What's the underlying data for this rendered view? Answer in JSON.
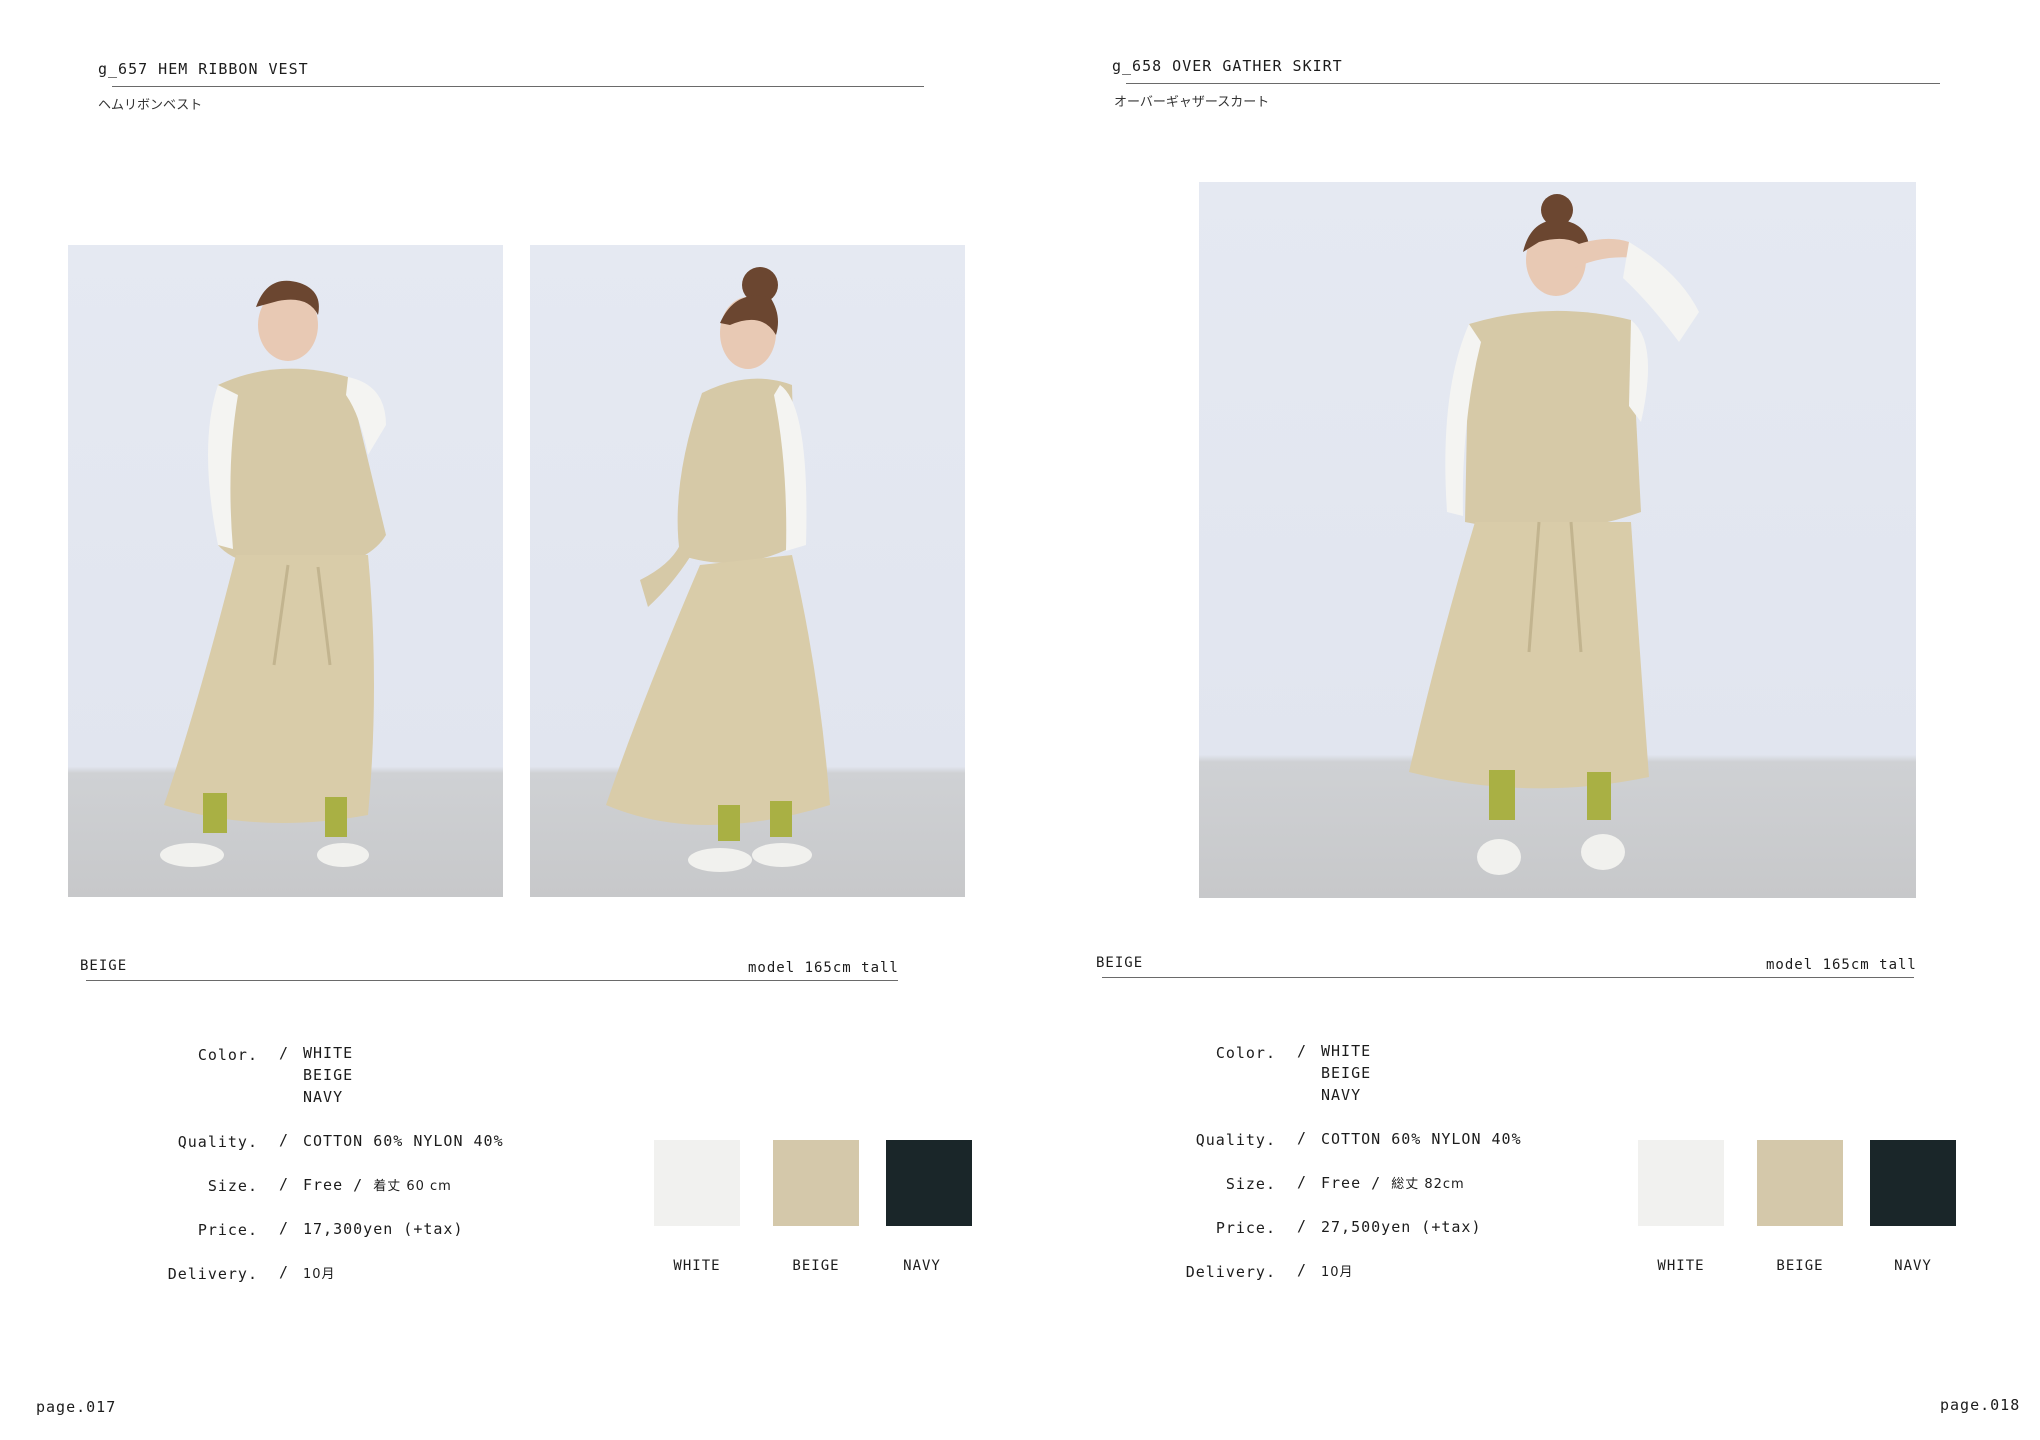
{
  "left": {
    "code_title": "g_657 HEM RIBBON VEST",
    "jp_title": "ヘムリボンベスト",
    "color_label": "BEIGE",
    "model_note": "model 165cm tall",
    "spec": {
      "color_key": "Color.",
      "colors": [
        "WHITE",
        "BEIGE",
        "NAVY"
      ],
      "quality_key": "Quality.",
      "quality": "COTTON 60% NYLON 40%",
      "size_key": "Size.",
      "size": "Free",
      "size_detail": "着丈 60 cm",
      "price_key": "Price.",
      "price": "17,300yen (+tax)",
      "delivery_key": "Delivery.",
      "delivery": "10月"
    },
    "swatches": [
      {
        "name": "WHITE",
        "color": "#f1f1ef"
      },
      {
        "name": "BEIGE",
        "color": "#d4c8aa"
      },
      {
        "name": "NAVY",
        "color": "#1a2629"
      }
    ],
    "page_number": "page.017"
  },
  "right": {
    "code_title": "g_658 OVER GATHER SKIRT",
    "jp_title": "オーバーギャザースカート",
    "color_label": "BEIGE",
    "model_note": "model 165cm tall",
    "spec": {
      "color_key": "Color.",
      "colors": [
        "WHITE",
        "BEIGE",
        "NAVY"
      ],
      "quality_key": "Quality.",
      "quality": "COTTON 60% NYLON 40%",
      "size_key": "Size.",
      "size": "Free",
      "size_detail": "総丈 82cm",
      "price_key": "Price.",
      "price": "27,500yen (+tax)",
      "delivery_key": "Delivery.",
      "delivery": "10月"
    },
    "swatches": [
      {
        "name": "WHITE",
        "color": "#f1f1ef"
      },
      {
        "name": "BEIGE",
        "color": "#d4c8aa"
      },
      {
        "name": "NAVY",
        "color": "#1a2629"
      }
    ],
    "page_number": "page.018"
  }
}
